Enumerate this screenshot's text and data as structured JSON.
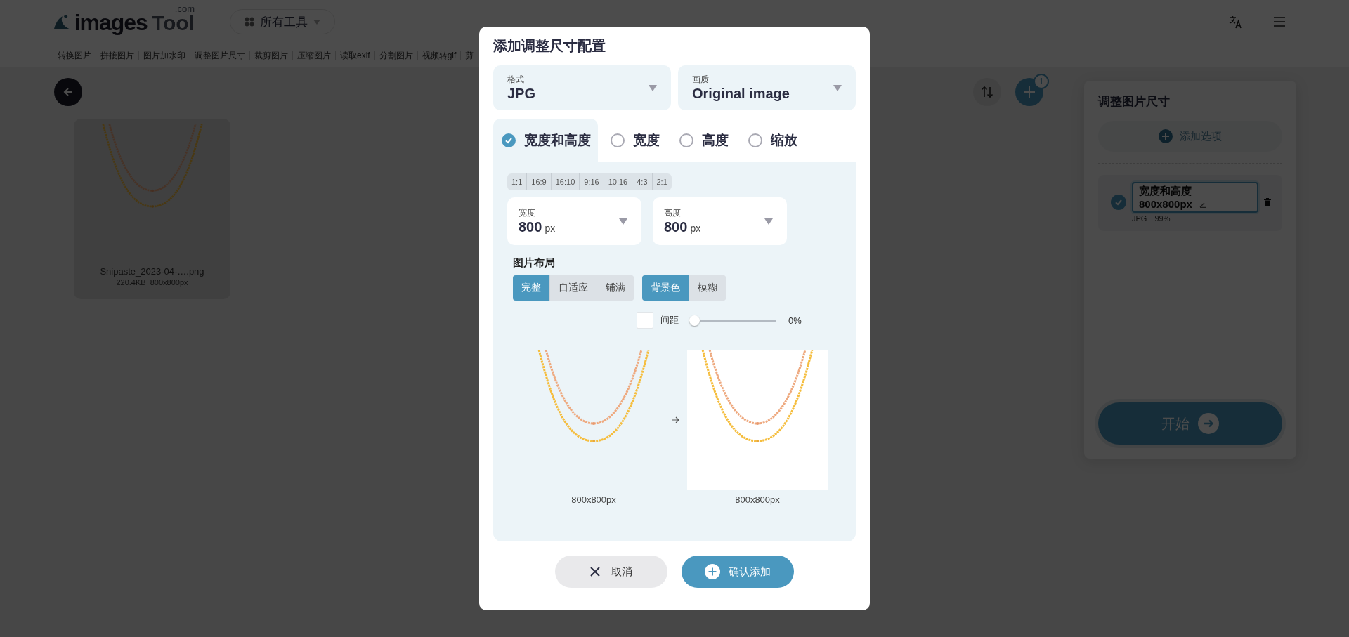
{
  "header": {
    "logo": {
      "word": "images",
      "word_light": "Tool",
      "suffix": ".com"
    },
    "tools_menu": {
      "label": "所有工具"
    },
    "nav_links": [
      "转换图片",
      "拼接图片",
      "图片加水印",
      "调整图片尺寸",
      "裁剪图片",
      "压缩图片",
      "读取exif",
      "分割图片",
      "视频转gif",
      "剪"
    ]
  },
  "files": [
    {
      "name": "Snipaste_2023-04-….png",
      "size": "220.4KB",
      "dimensions": "800x800px"
    }
  ],
  "add_badge": "1",
  "side_panel": {
    "title": "调整图片尺寸",
    "add_option": "添加选项",
    "configs": [
      {
        "selected": true,
        "title": "宽度和高度",
        "value": "800x800px",
        "format": "JPG",
        "quality": "99%"
      }
    ],
    "start_button": "开始"
  },
  "dialog": {
    "title": "添加调整尺寸配置",
    "selects": [
      {
        "label": "格式",
        "value": "JPG"
      },
      {
        "label": "画质",
        "value": "Original image"
      }
    ],
    "modes": [
      {
        "label": "宽度和高度",
        "selected": true
      },
      {
        "label": "宽度",
        "selected": false
      },
      {
        "label": "高度",
        "selected": false
      },
      {
        "label": "缩放",
        "selected": false
      }
    ],
    "ratios": [
      "1:1",
      "16:9",
      "16:10",
      "9:16",
      "10:16",
      "4:3",
      "2:1"
    ],
    "size_fields": [
      {
        "label": "宽度",
        "value": "800",
        "unit": "px"
      },
      {
        "label": "高度",
        "value": "800",
        "unit": "px"
      }
    ],
    "layout": {
      "title": "图片布局",
      "fit_options": [
        {
          "label": "完整",
          "selected": true
        },
        {
          "label": "自适应",
          "selected": false
        },
        {
          "label": "铺满",
          "selected": false
        }
      ],
      "fill_options": [
        {
          "label": "背景色",
          "selected": true
        },
        {
          "label": "模糊",
          "selected": false
        }
      ]
    },
    "spacing": {
      "label": "间距",
      "level": 0,
      "reading": "0%"
    },
    "previews": [
      {
        "kind": "source",
        "caption": "800x800px"
      },
      {
        "kind": "result",
        "caption": "800x800px"
      }
    ],
    "cancel_button": "取消",
    "confirm_button": "确认添加"
  }
}
